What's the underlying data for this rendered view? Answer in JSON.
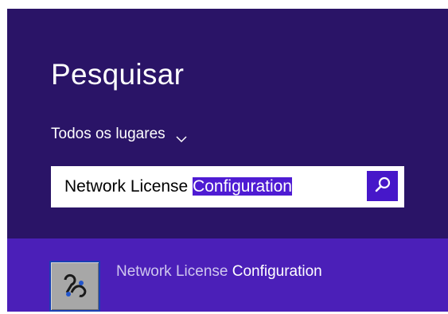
{
  "search_panel": {
    "title": "Pesquisar",
    "scope": {
      "label": "Todos os lugares",
      "icon": "chevron-down-icon"
    },
    "search": {
      "value_plain": "Network License ",
      "value_selected": "Configuration",
      "button_icon": "search-icon"
    }
  },
  "results": [
    {
      "name_match": "Network License",
      "name_rest": " Configuration",
      "icon": "network-license-app-icon"
    }
  ],
  "colors": {
    "panel_bg": "#2a1467",
    "results_bg": "#4b1fb8",
    "accent": "#4617c9",
    "selection": "#4e1bd3",
    "text": "#ffffff"
  }
}
